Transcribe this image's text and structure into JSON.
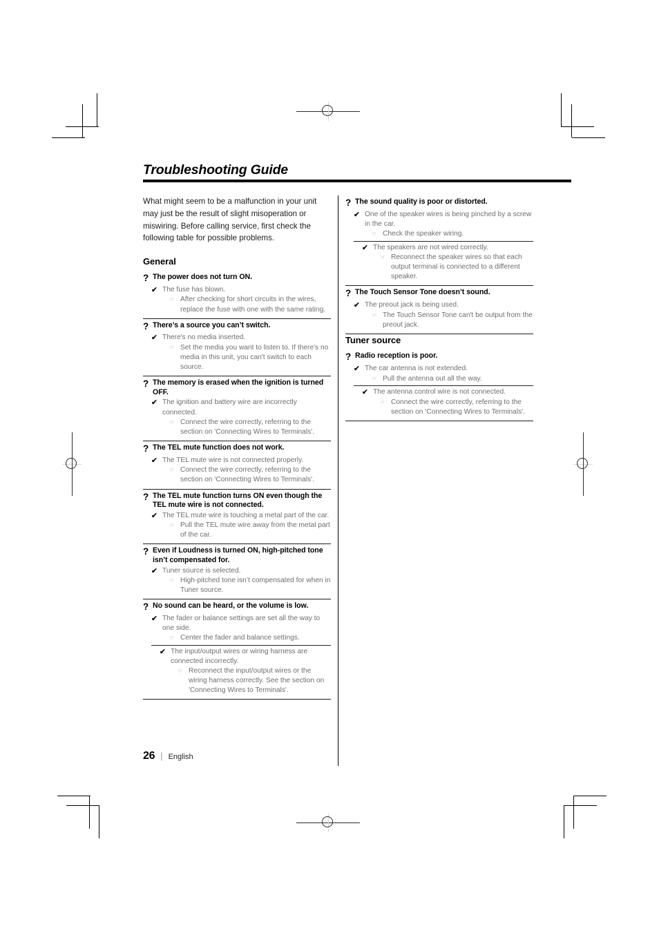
{
  "document": {
    "title": "Troubleshooting Guide",
    "intro": "What might seem to be a malfunction in your unit may just be the result of slight misoperation or miswiring. Before calling service, first check the following table for possible problems."
  },
  "glyphs": {
    "question": "?",
    "check": "✔",
    "hand": "☞"
  },
  "footer": {
    "page_number": "26",
    "separator": "|",
    "language": "English"
  },
  "left_column": {
    "section_title": "General",
    "entries": [
      {
        "question": "The power does not turn ON.",
        "causes": [
          {
            "cause": "The fuse has blown.",
            "fix": "After checking for short circuits in the wires, replace the fuse with one with the same rating."
          }
        ]
      },
      {
        "question": "There’s a source you can’t switch.",
        "causes": [
          {
            "cause": "There's no media inserted.",
            "fix": "Set the media you want to listen to. If there's no media in this unit, you can't switch to each source."
          }
        ]
      },
      {
        "question": "The memory is erased when the ignition is turned OFF.",
        "causes": [
          {
            "cause": "The ignition and battery wire are incorrectly connected.",
            "fix": "Connect the wire correctly, referring to the section on 'Connecting Wires to Terminals'."
          }
        ]
      },
      {
        "question": "The TEL mute function does not work.",
        "causes": [
          {
            "cause": "The TEL mute wire is not connected properly.",
            "fix": "Connect the wire correctly, referring to the section on 'Connecting Wires to Terminals'."
          }
        ]
      },
      {
        "question": "The TEL mute function turns ON even though the TEL mute wire is not connected.",
        "causes": [
          {
            "cause": "The TEL mute wire is touching a metal part of the car.",
            "fix": "Pull the TEL mute wire away from the metal part of the car."
          }
        ]
      },
      {
        "question": "Even if Loudness is turned ON, high-pitched tone isn’t compensated for.",
        "causes": [
          {
            "cause": "Tuner source is selected.",
            "fix": "High-pitched tone isn’t compensated for when in Tuner source."
          }
        ]
      },
      {
        "question": "No sound can be heard, or the volume is low.",
        "causes": [
          {
            "cause": "The fader or balance settings are set all the way to one side.",
            "fix": "Center the fader and balance settings."
          },
          {
            "cause": "The input/output wires or wiring harness are connected incorrectly.",
            "fix": "Reconnect the input/output wires or the wiring harness correctly. See the section on 'Connecting Wires to Terminals'."
          }
        ]
      }
    ]
  },
  "right_column": {
    "entries_top": [
      {
        "question": "The sound quality is poor or distorted.",
        "causes": [
          {
            "cause": "One of the speaker wires is being pinched by a screw in the car.",
            "fix": "Check the speaker wiring."
          },
          {
            "cause": "The speakers are not wired correctly.",
            "fix": "Reconnect the speaker wires so that each output terminal is connected to a different speaker."
          }
        ]
      },
      {
        "question": "The Touch Sensor Tone doesn’t sound.",
        "causes": [
          {
            "cause": "The preout jack is being used.",
            "fix": "The Touch Sensor Tone can't be output from the preout jack."
          }
        ]
      }
    ],
    "section_title": "Tuner source",
    "entries_bottom": [
      {
        "question": "Radio reception is poor.",
        "causes": [
          {
            "cause": "The car antenna is not extended.",
            "fix": "Pull the antenna out all the way."
          },
          {
            "cause": "The antenna control wire is not connected.",
            "fix": "Connect the wire correctly, referring to the section on 'Connecting Wires to Terminals'."
          }
        ]
      }
    ]
  }
}
